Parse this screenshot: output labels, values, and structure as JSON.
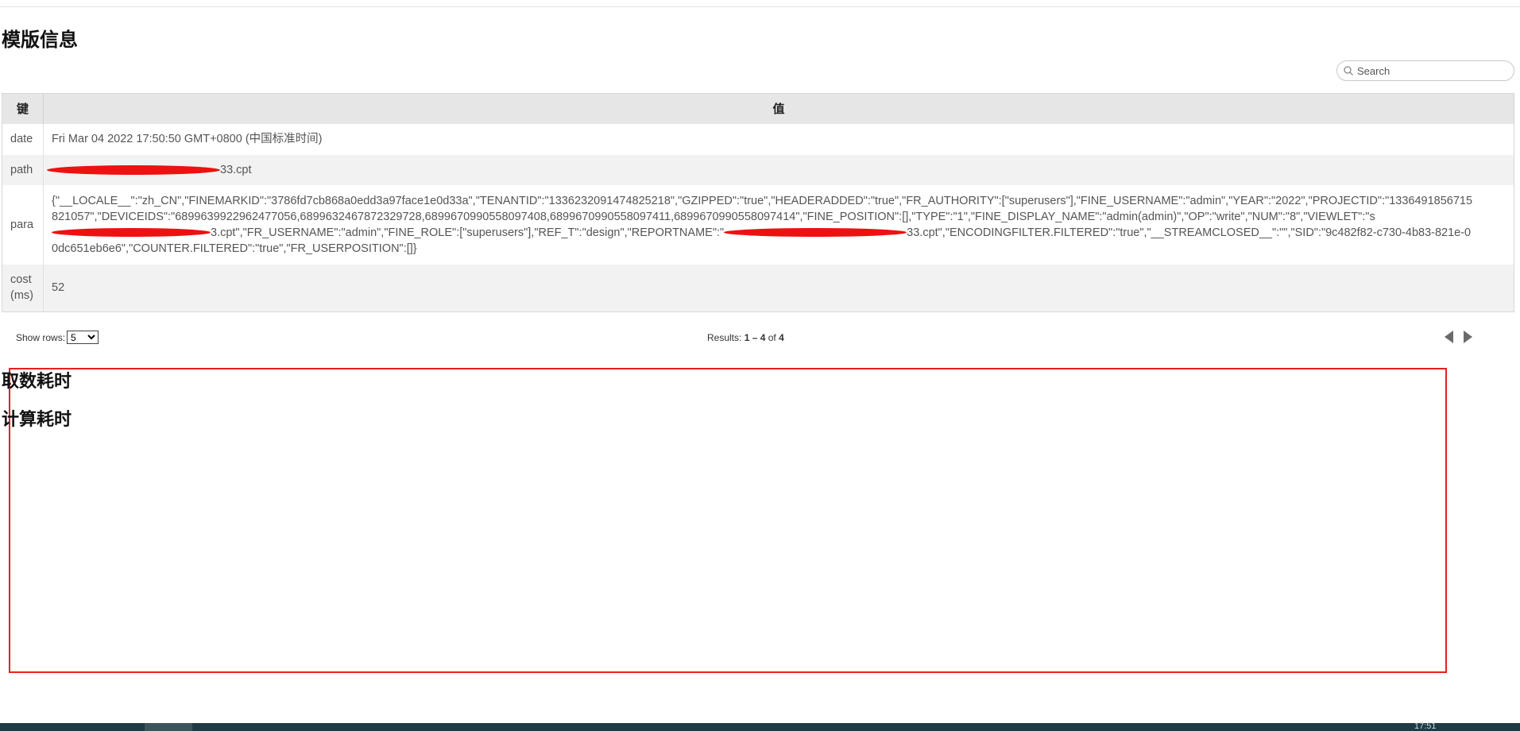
{
  "page": {
    "title": "模版信息"
  },
  "search": {
    "placeholder": "Search"
  },
  "table": {
    "headers": [
      "键",
      "值"
    ],
    "rows": [
      {
        "key": "date",
        "value": "Fri Mar 04 2022 17:50:50 GMT+0800 (中国标准时间)"
      },
      {
        "key": "path",
        "value_suffix": "33.cpt"
      },
      {
        "key": "para",
        "value_part1": "{\"__LOCALE__\":\"zh_CN\",\"FINEMARKID\":\"3786fd7cb868a0edd3a97face1e0d33a\",\"TENANTID\":\"1336232091474825218\",\"GZIPPED\":\"true\",\"HEADERADDED\":\"true\",\"FR_AUTHORITY\":[\"superusers\"],\"FINE_USERNAME\":\"admin\",\"YEAR\":\"2022\",\"PROJECTID\":\"1336491856715821057\",\"DEVICEIDS\":\"6899639922962477056,6899632467872329728,6899670990558097408,6899670990558097411,6899670990558097414\",\"FINE_POSITION\":[],\"TYPE\":\"1\",\"FINE_DISPLAY_NAME\":\"admin(admin)\",\"OP\":\"write\",\"NUM\":\"8\",\"VIEWLET\":\"s",
        "value_part2": "3.cpt\",\"FR_USERNAME\":\"admin\",\"FINE_ROLE\":[\"superusers\"],\"REF_T\":\"design\",\"REPORTNAME\":\"",
        "value_part3": "33.cpt\",\"ENCODINGFILTER.FILTERED\":\"true\",\"__STREAMCLOSED__\":\"\",\"SID\":\"9c482f82-c730-4b83-821e-00dc651eb6e6\",\"COUNTER.FILTERED\":\"true\",\"FR_USERPOSITION\":[]}"
      },
      {
        "key": "cost (ms)",
        "value": "52"
      }
    ]
  },
  "pager": {
    "show_rows_label": "Show rows:",
    "rows_option": "5",
    "results_prefix": "Results: ",
    "results_range": "1 – 4",
    "results_of": " of ",
    "results_total": "4"
  },
  "sections": {
    "fetch_time": "取数耗时",
    "calc_time": "计算耗时"
  },
  "taskbar": {
    "clock": "17:51"
  },
  "colors": {
    "header_bg": "#e6e6e6",
    "zebra_bg": "#f2f2f2",
    "highlight_border": "#e82020",
    "redaction": "#ee1111"
  }
}
